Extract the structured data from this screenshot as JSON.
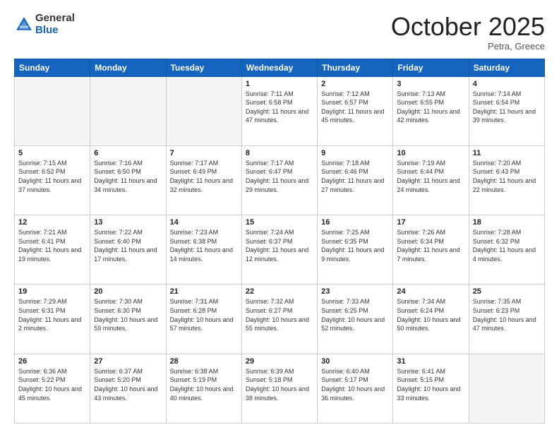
{
  "header": {
    "logo_general": "General",
    "logo_blue": "Blue",
    "month": "October 2025",
    "location": "Petra, Greece"
  },
  "days_of_week": [
    "Sunday",
    "Monday",
    "Tuesday",
    "Wednesday",
    "Thursday",
    "Friday",
    "Saturday"
  ],
  "weeks": [
    [
      {
        "day": "",
        "info": ""
      },
      {
        "day": "",
        "info": ""
      },
      {
        "day": "",
        "info": ""
      },
      {
        "day": "1",
        "info": "Sunrise: 7:11 AM\nSunset: 6:58 PM\nDaylight: 11 hours and 47 minutes."
      },
      {
        "day": "2",
        "info": "Sunrise: 7:12 AM\nSunset: 6:57 PM\nDaylight: 11 hours and 45 minutes."
      },
      {
        "day": "3",
        "info": "Sunrise: 7:13 AM\nSunset: 6:55 PM\nDaylight: 11 hours and 42 minutes."
      },
      {
        "day": "4",
        "info": "Sunrise: 7:14 AM\nSunset: 6:54 PM\nDaylight: 11 hours and 39 minutes."
      }
    ],
    [
      {
        "day": "5",
        "info": "Sunrise: 7:15 AM\nSunset: 6:52 PM\nDaylight: 11 hours and 37 minutes."
      },
      {
        "day": "6",
        "info": "Sunrise: 7:16 AM\nSunset: 6:50 PM\nDaylight: 11 hours and 34 minutes."
      },
      {
        "day": "7",
        "info": "Sunrise: 7:17 AM\nSunset: 6:49 PM\nDaylight: 11 hours and 32 minutes."
      },
      {
        "day": "8",
        "info": "Sunrise: 7:17 AM\nSunset: 6:47 PM\nDaylight: 11 hours and 29 minutes."
      },
      {
        "day": "9",
        "info": "Sunrise: 7:18 AM\nSunset: 6:46 PM\nDaylight: 11 hours and 27 minutes."
      },
      {
        "day": "10",
        "info": "Sunrise: 7:19 AM\nSunset: 6:44 PM\nDaylight: 11 hours and 24 minutes."
      },
      {
        "day": "11",
        "info": "Sunrise: 7:20 AM\nSunset: 6:43 PM\nDaylight: 11 hours and 22 minutes."
      }
    ],
    [
      {
        "day": "12",
        "info": "Sunrise: 7:21 AM\nSunset: 6:41 PM\nDaylight: 11 hours and 19 minutes."
      },
      {
        "day": "13",
        "info": "Sunrise: 7:22 AM\nSunset: 6:40 PM\nDaylight: 11 hours and 17 minutes."
      },
      {
        "day": "14",
        "info": "Sunrise: 7:23 AM\nSunset: 6:38 PM\nDaylight: 11 hours and 14 minutes."
      },
      {
        "day": "15",
        "info": "Sunrise: 7:24 AM\nSunset: 6:37 PM\nDaylight: 11 hours and 12 minutes."
      },
      {
        "day": "16",
        "info": "Sunrise: 7:25 AM\nSunset: 6:35 PM\nDaylight: 11 hours and 9 minutes."
      },
      {
        "day": "17",
        "info": "Sunrise: 7:26 AM\nSunset: 6:34 PM\nDaylight: 11 hours and 7 minutes."
      },
      {
        "day": "18",
        "info": "Sunrise: 7:28 AM\nSunset: 6:32 PM\nDaylight: 11 hours and 4 minutes."
      }
    ],
    [
      {
        "day": "19",
        "info": "Sunrise: 7:29 AM\nSunset: 6:31 PM\nDaylight: 11 hours and 2 minutes."
      },
      {
        "day": "20",
        "info": "Sunrise: 7:30 AM\nSunset: 6:30 PM\nDaylight: 10 hours and 59 minutes."
      },
      {
        "day": "21",
        "info": "Sunrise: 7:31 AM\nSunset: 6:28 PM\nDaylight: 10 hours and 57 minutes."
      },
      {
        "day": "22",
        "info": "Sunrise: 7:32 AM\nSunset: 6:27 PM\nDaylight: 10 hours and 55 minutes."
      },
      {
        "day": "23",
        "info": "Sunrise: 7:33 AM\nSunset: 6:25 PM\nDaylight: 10 hours and 52 minutes."
      },
      {
        "day": "24",
        "info": "Sunrise: 7:34 AM\nSunset: 6:24 PM\nDaylight: 10 hours and 50 minutes."
      },
      {
        "day": "25",
        "info": "Sunrise: 7:35 AM\nSunset: 6:23 PM\nDaylight: 10 hours and 47 minutes."
      }
    ],
    [
      {
        "day": "26",
        "info": "Sunrise: 6:36 AM\nSunset: 5:22 PM\nDaylight: 10 hours and 45 minutes."
      },
      {
        "day": "27",
        "info": "Sunrise: 6:37 AM\nSunset: 5:20 PM\nDaylight: 10 hours and 43 minutes."
      },
      {
        "day": "28",
        "info": "Sunrise: 6:38 AM\nSunset: 5:19 PM\nDaylight: 10 hours and 40 minutes."
      },
      {
        "day": "29",
        "info": "Sunrise: 6:39 AM\nSunset: 5:18 PM\nDaylight: 10 hours and 38 minutes."
      },
      {
        "day": "30",
        "info": "Sunrise: 6:40 AM\nSunset: 5:17 PM\nDaylight: 10 hours and 36 minutes."
      },
      {
        "day": "31",
        "info": "Sunrise: 6:41 AM\nSunset: 5:15 PM\nDaylight: 10 hours and 33 minutes."
      },
      {
        "day": "",
        "info": ""
      }
    ]
  ]
}
